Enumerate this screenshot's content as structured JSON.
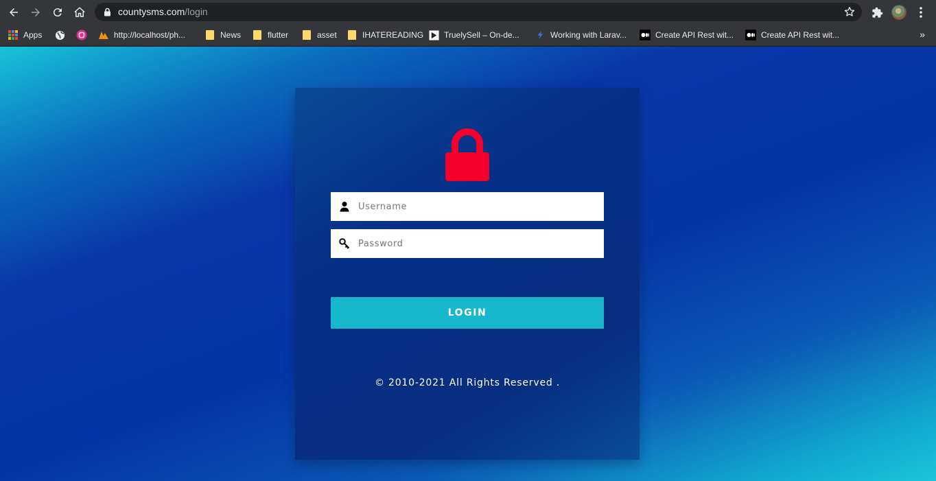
{
  "browser": {
    "url_host": "countysms.com",
    "url_path": "/login"
  },
  "bookmarks": [
    {
      "label": "Apps",
      "icon": "apps-grid-icon"
    },
    {
      "label": "",
      "icon": "globe-icon"
    },
    {
      "label": "",
      "icon": "pink-circle-icon"
    },
    {
      "label": "http://localhost/ph...",
      "icon": "pma-icon"
    },
    {
      "label": "News",
      "icon": "folder-icon"
    },
    {
      "label": "flutter",
      "icon": "folder-icon"
    },
    {
      "label": "asset",
      "icon": "folder-icon"
    },
    {
      "label": "IHATEREADING",
      "icon": "folder-icon"
    },
    {
      "label": "TruelySell – On-de...",
      "icon": "truelysell-icon"
    },
    {
      "label": "Working with Larav...",
      "icon": "laravel-icon"
    },
    {
      "label": "Create API Rest wit...",
      "icon": "medium-icon"
    },
    {
      "label": "Create API Rest wit...",
      "icon": "medium-icon"
    }
  ],
  "login": {
    "username_placeholder": "Username",
    "password_placeholder": "Password",
    "button_label": "LOGIN",
    "footer": "© 2010-2021 All Rights Reserved ."
  },
  "colors": {
    "lock": "#f5002e",
    "button": "#17b8cc",
    "card": "#062e86"
  }
}
